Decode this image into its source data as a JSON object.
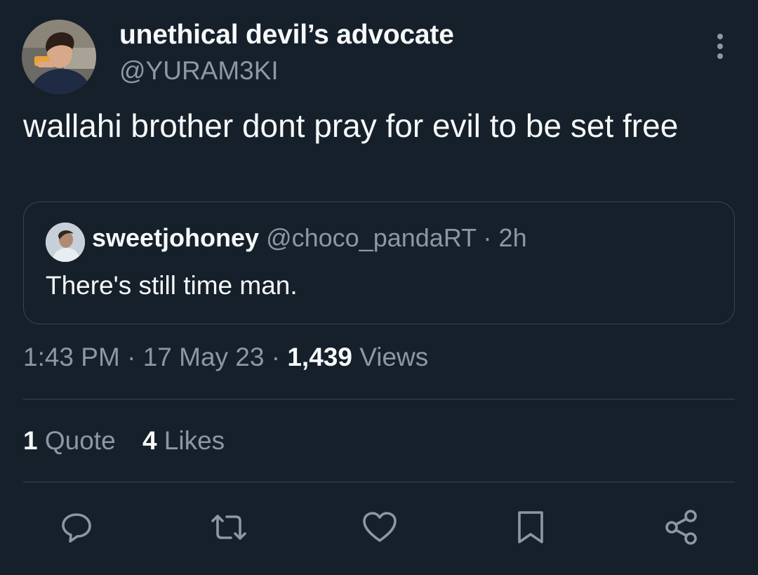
{
  "tweet": {
    "author": {
      "display_name": "unethical devil’s advocate",
      "handle": "@YURAM3KI"
    },
    "text": "wallahi brother dont pray for evil to be set free",
    "quoted_tweet": {
      "display_name": "sweetjohoney",
      "handle": "@choco_pandaRT",
      "separator": "·",
      "time": "2h",
      "text": "There's still time man."
    },
    "meta": {
      "time": "1:43 PM",
      "separator": "·",
      "date": "17 May 23",
      "views_count": "1,439",
      "views_label": "Views"
    },
    "stats": {
      "quotes_count": "1",
      "quotes_label": "Quote",
      "likes_count": "4",
      "likes_label": "Likes"
    }
  },
  "actions": [
    {
      "icon": "reply-icon"
    },
    {
      "icon": "retweet-icon"
    },
    {
      "icon": "heart-icon"
    },
    {
      "icon": "bookmark-icon"
    },
    {
      "icon": "share-icon"
    }
  ],
  "colors": {
    "background": "#15202b",
    "primary_text": "#f7f9f9",
    "secondary_text": "#8b98a5",
    "border": "#38444d"
  }
}
